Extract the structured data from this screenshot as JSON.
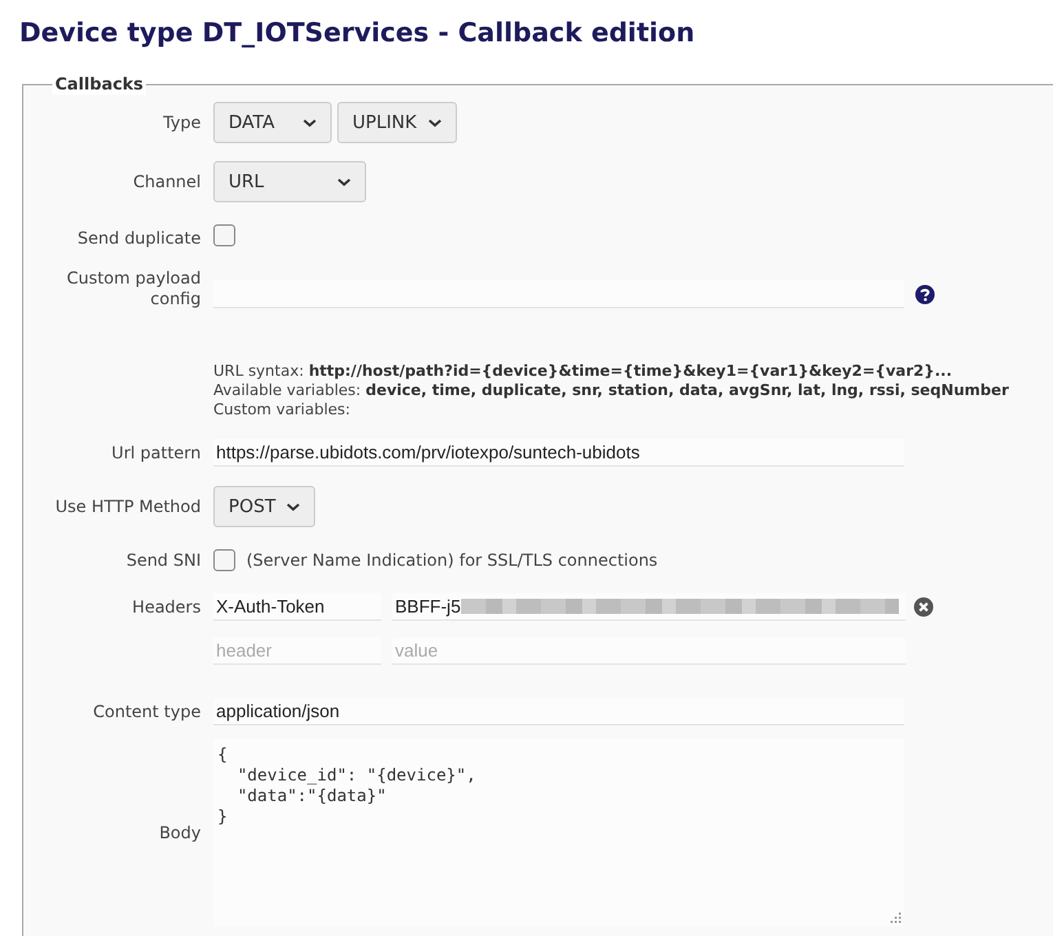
{
  "title": "Device type DT_IOTServices - Callback edition",
  "callbacks": {
    "legend": "Callbacks",
    "type": {
      "label": "Type",
      "selects": [
        {
          "value": "DATA"
        },
        {
          "value": "UPLINK"
        }
      ]
    },
    "channel": {
      "label": "Channel",
      "value": "URL"
    },
    "send_duplicate": {
      "label": "Send duplicate",
      "checked": false
    },
    "custom_payload": {
      "label": "Custom payload config"
    },
    "help": [
      {
        "label": "URL syntax:",
        "value": "http://host/path?id={device}&time={time}&key1={var1}&key2={var2}..."
      },
      {
        "label": "Available variables:",
        "value": "device, time, duplicate, snr, station, data, avgSnr, lat, lng, rssi, seqNumber"
      },
      {
        "label": "Custom variables:"
      }
    ],
    "url_pattern": {
      "label": "Url pattern",
      "value": "https://parse.ubidots.com/prv/iotexpo/suntech-ubidots"
    },
    "http_method": {
      "label": "Use HTTP Method",
      "value": "POST"
    },
    "send_sni": {
      "label": "Send SNI",
      "checked": false,
      "note": "(Server Name Indication) for SSL/TLS connections"
    },
    "headers": {
      "label": "Headers",
      "rows": [
        {
          "name": "X-Auth-Token",
          "value": "BBFF-j5"
        }
      ],
      "new_row": {
        "name_placeholder": "header",
        "value_placeholder": "value"
      }
    },
    "content_type": {
      "label": "Content type",
      "value": "application/json"
    },
    "body": {
      "label": "Body",
      "value": "{\n  \"device_id\": \"{device}\",\n  \"data\":\"{data}\"\n}"
    }
  }
}
